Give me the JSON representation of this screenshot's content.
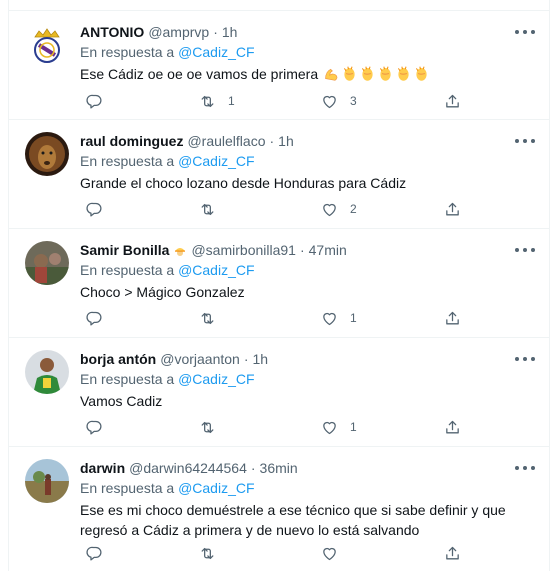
{
  "tweets": [
    {
      "name": "ANTONIO",
      "handle": "@amprvp",
      "time": "1h",
      "reply_prefix": "En respuesta a",
      "reply_to": "@Cadiz_CF",
      "text": "Ese Cádiz oe oe oe vamos de primera",
      "emojis": [
        "flexed-biceps",
        "clapping-hands",
        "clapping-hands",
        "clapping-hands",
        "clapping-hands",
        "clapping-hands"
      ],
      "replies": "",
      "retweets": "1",
      "likes": "3"
    },
    {
      "name": "raul dominguez",
      "handle": "@raulelflaco",
      "time": "1h",
      "reply_prefix": "En respuesta a",
      "reply_to": "@Cadiz_CF",
      "text": "Grande el choco lozano desde Honduras para Cádiz",
      "replies": "",
      "retweets": "",
      "likes": "2"
    },
    {
      "name": "Samir Bonilla",
      "handle": "@samirbonilla91",
      "time": "47min",
      "reply_prefix": "En respuesta a",
      "reply_to": "@Cadiz_CF",
      "text": "Choco > Mágico Gonzalez",
      "replies": "",
      "retweets": "",
      "likes": "1"
    },
    {
      "name": "borja antón",
      "handle": "@vorjaanton",
      "time": "1h",
      "reply_prefix": "En respuesta a",
      "reply_to": "@Cadiz_CF",
      "text": "Vamos Cadiz",
      "replies": "",
      "retweets": "",
      "likes": "1"
    },
    {
      "name": "darwin",
      "handle": "@darwin64244564",
      "time": "36min",
      "reply_prefix": "En respuesta a",
      "reply_to": "@Cadiz_CF",
      "text": "Ese es mi choco demuéstrele a ese técnico que si sabe definir y que regresó a Cádiz a primera y de nuevo lo está salvando",
      "replies": "",
      "retweets": "",
      "likes": ""
    }
  ],
  "separator": "·",
  "colors": {
    "link": "#1d9bf0",
    "muted": "#536471",
    "text": "#0f1419",
    "border": "#eff3f4"
  }
}
